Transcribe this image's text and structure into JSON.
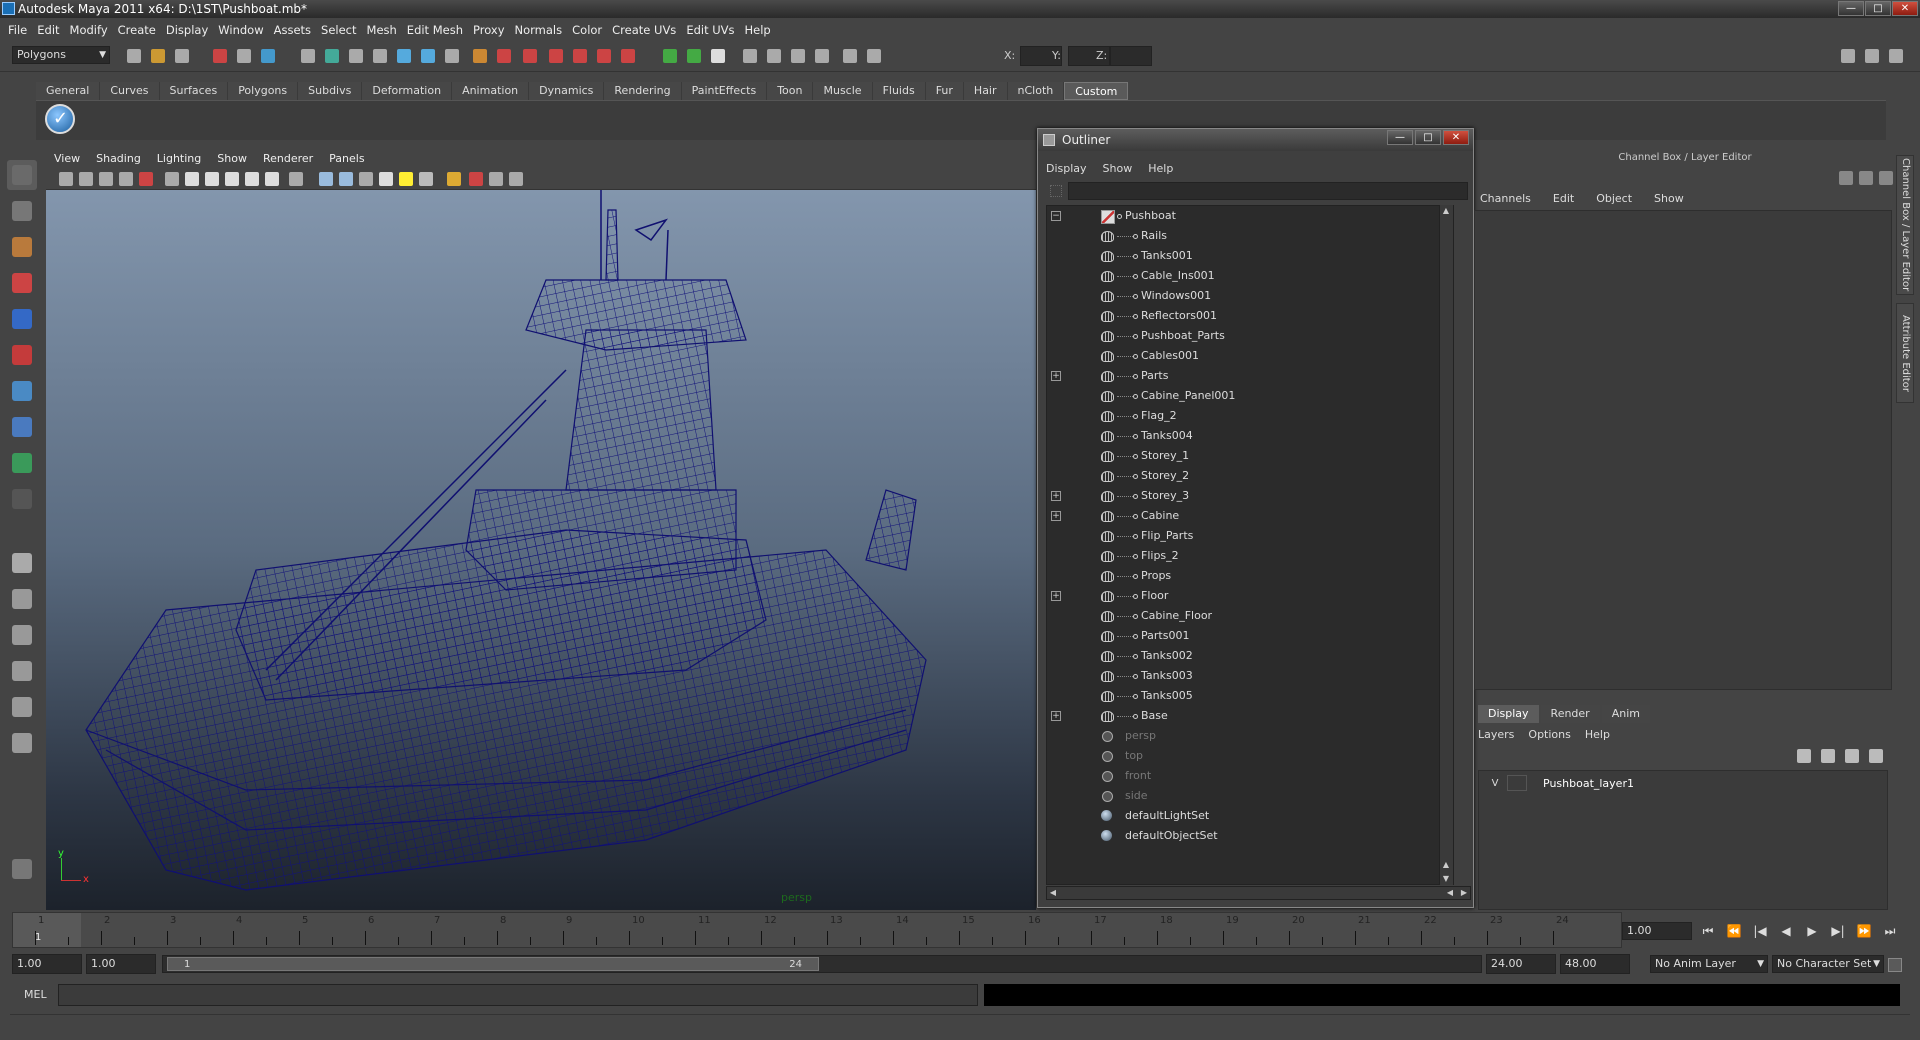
{
  "window": {
    "title": "Autodesk Maya 2011 x64: D:\\1ST\\Pushboat.mb*",
    "buttons": {
      "minimize": "—",
      "maximize": "□",
      "close": "✕"
    }
  },
  "menubar": [
    "File",
    "Edit",
    "Modify",
    "Create",
    "Display",
    "Window",
    "Assets",
    "Select",
    "Mesh",
    "Edit Mesh",
    "Proxy",
    "Normals",
    "Color",
    "Create UVs",
    "Edit UVs",
    "Help"
  ],
  "statusline": {
    "menuset": "Polygons",
    "x_label": "X:",
    "y_label": "Y:",
    "z_label": "Z:"
  },
  "shelf": {
    "tabs": [
      "General",
      "Curves",
      "Surfaces",
      "Polygons",
      "Subdivs",
      "Deformation",
      "Animation",
      "Dynamics",
      "Rendering",
      "PaintEffects",
      "Toon",
      "Muscle",
      "Fluids",
      "Fur",
      "Hair",
      "nCloth",
      "Custom"
    ],
    "active_tab": "Custom"
  },
  "viewport": {
    "menu": [
      "View",
      "Shading",
      "Lighting",
      "Show",
      "Renderer",
      "Panels"
    ],
    "camera_label": "persp",
    "axis_x": "x",
    "axis_y": "y"
  },
  "outliner": {
    "title": "Outliner",
    "menu": [
      "Display",
      "Show",
      "Help"
    ],
    "items": [
      {
        "label": "Pushboat",
        "depth": 0,
        "icon": "root",
        "expander": "−"
      },
      {
        "label": "Rails",
        "depth": 1,
        "icon": "mesh"
      },
      {
        "label": "Tanks001",
        "depth": 1,
        "icon": "mesh"
      },
      {
        "label": "Cable_Ins001",
        "depth": 1,
        "icon": "mesh"
      },
      {
        "label": "Windows001",
        "depth": 1,
        "icon": "mesh"
      },
      {
        "label": "Reflectors001",
        "depth": 1,
        "icon": "mesh"
      },
      {
        "label": "Pushboat_Parts",
        "depth": 1,
        "icon": "mesh"
      },
      {
        "label": "Cables001",
        "depth": 1,
        "icon": "mesh"
      },
      {
        "label": "Parts",
        "depth": 1,
        "icon": "mesh",
        "expander": "+"
      },
      {
        "label": "Cabine_Panel001",
        "depth": 1,
        "icon": "mesh"
      },
      {
        "label": "Flag_2",
        "depth": 1,
        "icon": "mesh"
      },
      {
        "label": "Tanks004",
        "depth": 1,
        "icon": "mesh"
      },
      {
        "label": "Storey_1",
        "depth": 1,
        "icon": "mesh"
      },
      {
        "label": "Storey_2",
        "depth": 1,
        "icon": "mesh"
      },
      {
        "label": "Storey_3",
        "depth": 1,
        "icon": "mesh",
        "expander": "+"
      },
      {
        "label": "Cabine",
        "depth": 1,
        "icon": "mesh",
        "expander": "+"
      },
      {
        "label": "Flip_Parts",
        "depth": 1,
        "icon": "mesh"
      },
      {
        "label": "Flips_2",
        "depth": 1,
        "icon": "mesh"
      },
      {
        "label": "Props",
        "depth": 1,
        "icon": "mesh"
      },
      {
        "label": "Floor",
        "depth": 1,
        "icon": "mesh",
        "expander": "+"
      },
      {
        "label": "Cabine_Floor",
        "depth": 1,
        "icon": "mesh"
      },
      {
        "label": "Parts001",
        "depth": 1,
        "icon": "mesh"
      },
      {
        "label": "Tanks002",
        "depth": 1,
        "icon": "mesh"
      },
      {
        "label": "Tanks003",
        "depth": 1,
        "icon": "mesh"
      },
      {
        "label": "Tanks005",
        "depth": 1,
        "icon": "mesh"
      },
      {
        "label": "Base",
        "depth": 1,
        "icon": "mesh",
        "expander": "+"
      },
      {
        "label": "persp",
        "depth": 0,
        "icon": "cam",
        "dim": true
      },
      {
        "label": "top",
        "depth": 0,
        "icon": "cam",
        "dim": true
      },
      {
        "label": "front",
        "depth": 0,
        "icon": "cam",
        "dim": true
      },
      {
        "label": "side",
        "depth": 0,
        "icon": "cam",
        "dim": true
      },
      {
        "label": "defaultLightSet",
        "depth": 0,
        "icon": "set"
      },
      {
        "label": "defaultObjectSet",
        "depth": 0,
        "icon": "set"
      }
    ]
  },
  "channelbox": {
    "title": "Channel Box / Layer Editor",
    "menu": [
      "Channels",
      "Edit",
      "Object",
      "Show"
    ],
    "side_tabs": [
      "Channel Box / Layer Editor",
      "Attribute Editor"
    ]
  },
  "layers": {
    "tabs": [
      "Display",
      "Render",
      "Anim"
    ],
    "active_tab": "Display",
    "menu": [
      "Layers",
      "Options",
      "Help"
    ],
    "rows": [
      {
        "visible": "V",
        "name": "Pushboat_layer1"
      }
    ]
  },
  "timeline": {
    "ticks": [
      "1",
      "2",
      "3",
      "4",
      "5",
      "6",
      "7",
      "8",
      "9",
      "10",
      "11",
      "12",
      "13",
      "14",
      "15",
      "16",
      "17",
      "18",
      "19",
      "20",
      "21",
      "22",
      "23",
      "24"
    ],
    "current_frame": "1",
    "current_frame_field": "1.00",
    "playback_buttons": [
      "⏮",
      "⏪",
      "|◀",
      "◀",
      "▶",
      "▶|",
      "⏩",
      "⏭"
    ]
  },
  "range": {
    "start_time": "1.00",
    "playback_start": "1.00",
    "handle_start": "1",
    "handle_end": "24",
    "playback_end": "24.00",
    "end_time": "48.00",
    "anim_layer": "No Anim Layer",
    "character_set": "No Character Set"
  },
  "commandline": {
    "label": "MEL"
  }
}
